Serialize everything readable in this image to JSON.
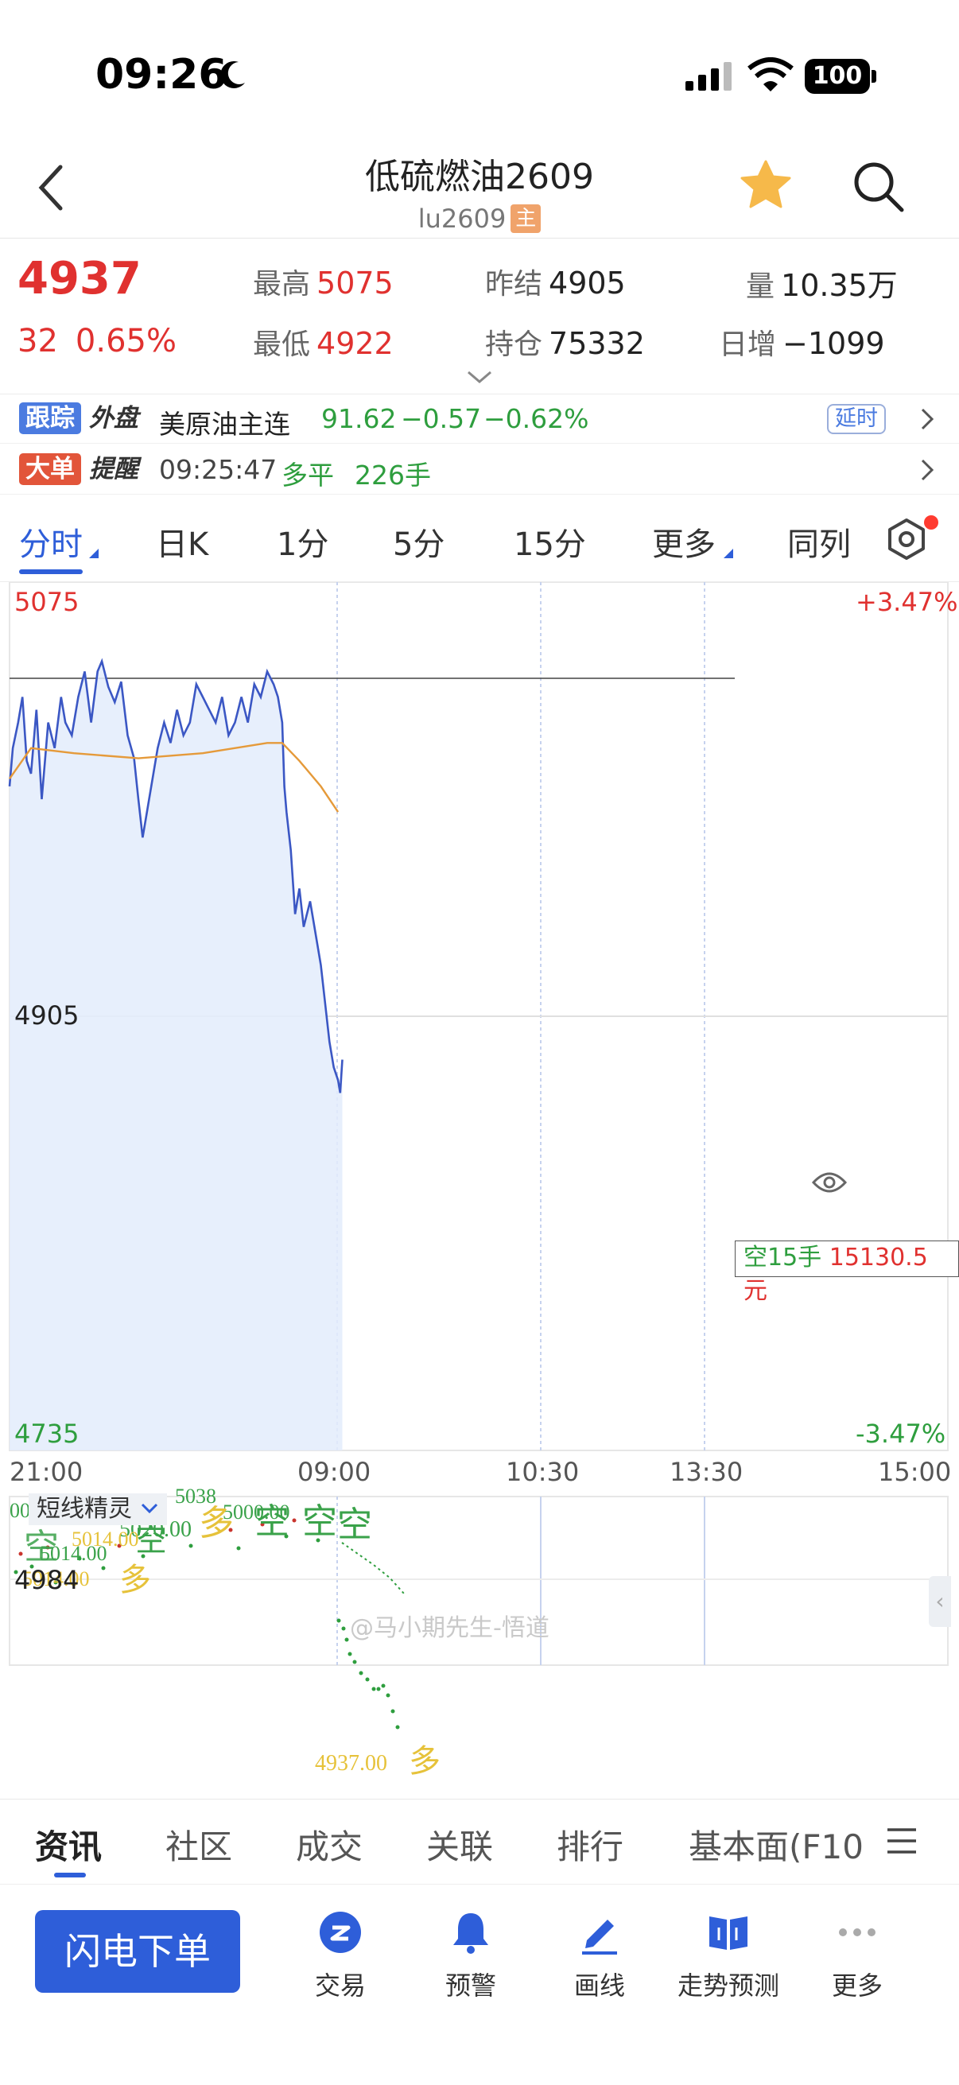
{
  "status_bar": {
    "time": "09:26",
    "battery": "100"
  },
  "nav": {
    "title": "低硫燃油2609",
    "subtitle": "lu2609",
    "badge": "主"
  },
  "quote": {
    "price": "4937",
    "change": "32",
    "change_pct": "0.65%",
    "high_label": "最高",
    "high": "5075",
    "low_label": "最低",
    "low": "4922",
    "prev_settle_label": "昨结",
    "prev_settle": "4905",
    "open_interest_label": "持仓",
    "open_interest": "75332",
    "volume_label": "量",
    "volume": "10.35万",
    "daily_inc_label": "日增",
    "daily_inc": "−1099"
  },
  "external": {
    "tag_a": "跟踪",
    "tag_b": "外盘",
    "name": "美原油主连",
    "price": "91.62",
    "change": "−0.57",
    "pct": "−0.62%",
    "delay": "延时"
  },
  "alert": {
    "tag_a": "大单",
    "tag_b": "提醒",
    "time": "09:25:47",
    "type": "多平",
    "qty": "226手"
  },
  "tabs": [
    {
      "label": "分时"
    },
    {
      "label": "日K"
    },
    {
      "label": "1分"
    },
    {
      "label": "5分"
    },
    {
      "label": "15分"
    },
    {
      "label": "更多"
    },
    {
      "label": "同列"
    }
  ],
  "chart": {
    "y_top": "5075",
    "y_mid": "4905",
    "y_bottom": "4735",
    "pct_top": "+3.47%",
    "pct_bottom": "-3.47%",
    "position_label": "空15手",
    "position_value": "15130.5元",
    "x_labels": [
      "21:00",
      "09:00",
      "10:30",
      "13:30",
      "15:00"
    ],
    "watermark": "@马小期先生-悟道",
    "sub_button": "短线精灵",
    "sub_y": "4984",
    "sub_marker_price": "4937.00",
    "sub_marker_label": "多"
  },
  "chart_data": {
    "type": "line",
    "title": "",
    "ylim": [
      4735,
      5075
    ],
    "reference": 4905,
    "x": [
      "21:00",
      "09:00",
      "10:30",
      "13:30",
      "15:00"
    ],
    "series": [
      {
        "name": "",
        "color": "#3b57c4",
        "points": [
          [
            0,
            4995
          ],
          [
            3,
            5010
          ],
          [
            8,
            5020
          ],
          [
            12,
            5030
          ],
          [
            16,
            5005
          ],
          [
            20,
            5000
          ],
          [
            25,
            5025
          ],
          [
            30,
            4990
          ],
          [
            36,
            5020
          ],
          [
            42,
            5010
          ],
          [
            48,
            5030
          ],
          [
            52,
            5020
          ],
          [
            58,
            5015
          ],
          [
            64,
            5030
          ],
          [
            70,
            5040
          ],
          [
            76,
            5020
          ],
          [
            82,
            5040
          ],
          [
            86,
            5044
          ],
          [
            92,
            5034
          ],
          [
            98,
            5028
          ],
          [
            104,
            5036
          ],
          [
            110,
            5015
          ],
          [
            116,
            5006
          ],
          [
            120,
            4990
          ],
          [
            124,
            4975
          ],
          [
            128,
            4985
          ],
          [
            134,
            5000
          ],
          [
            138,
            5010
          ],
          [
            144,
            5020
          ],
          [
            150,
            5012
          ],
          [
            156,
            5025
          ],
          [
            162,
            5015
          ],
          [
            168,
            5020
          ],
          [
            174,
            5035
          ],
          [
            180,
            5030
          ],
          [
            186,
            5025
          ],
          [
            192,
            5020
          ],
          [
            198,
            5030
          ],
          [
            204,
            5015
          ],
          [
            210,
            5020
          ],
          [
            216,
            5030
          ],
          [
            222,
            5020
          ],
          [
            228,
            5035
          ],
          [
            234,
            5030
          ],
          [
            240,
            5040
          ],
          [
            246,
            5035
          ],
          [
            250,
            5030
          ],
          [
            254,
            5020
          ],
          [
            256,
            4995
          ],
          [
            258,
            4985
          ],
          [
            262,
            4970
          ],
          [
            266,
            4945
          ],
          [
            270,
            4955
          ],
          [
            274,
            4940
          ],
          [
            280,
            4950
          ],
          [
            286,
            4935
          ],
          [
            290,
            4925
          ],
          [
            294,
            4910
          ],
          [
            298,
            4895
          ],
          [
            302,
            4885
          ],
          [
            306,
            4880
          ],
          [
            308,
            4875
          ],
          [
            310,
            4888
          ]
        ]
      },
      {
        "name": "",
        "color": "#e59a3a",
        "points": [
          [
            0,
            4998
          ],
          [
            20,
            5010
          ],
          [
            60,
            5008
          ],
          [
            120,
            5006
          ],
          [
            180,
            5008
          ],
          [
            240,
            5012
          ],
          [
            254,
            5012
          ],
          [
            270,
            5005
          ],
          [
            290,
            4995
          ],
          [
            306,
            4985
          ]
        ]
      }
    ]
  },
  "bottom_tabs": [
    {
      "label": "资讯"
    },
    {
      "label": "社区"
    },
    {
      "label": "成交"
    },
    {
      "label": "关联"
    },
    {
      "label": "排行"
    },
    {
      "label": "基本面(F10"
    }
  ],
  "toolbar": {
    "flash_order": "闪电下单",
    "items": [
      {
        "label": "交易",
        "icon": "trade-icon"
      },
      {
        "label": "预警",
        "icon": "bell-icon"
      },
      {
        "label": "画线",
        "icon": "pen-icon"
      },
      {
        "label": "走势预测",
        "icon": "book-icon"
      },
      {
        "label": "更多",
        "icon": "more-icon"
      }
    ]
  },
  "colors": {
    "up": "#e0312f",
    "down": "#2e9e3e",
    "accent": "#2e5ed9"
  }
}
